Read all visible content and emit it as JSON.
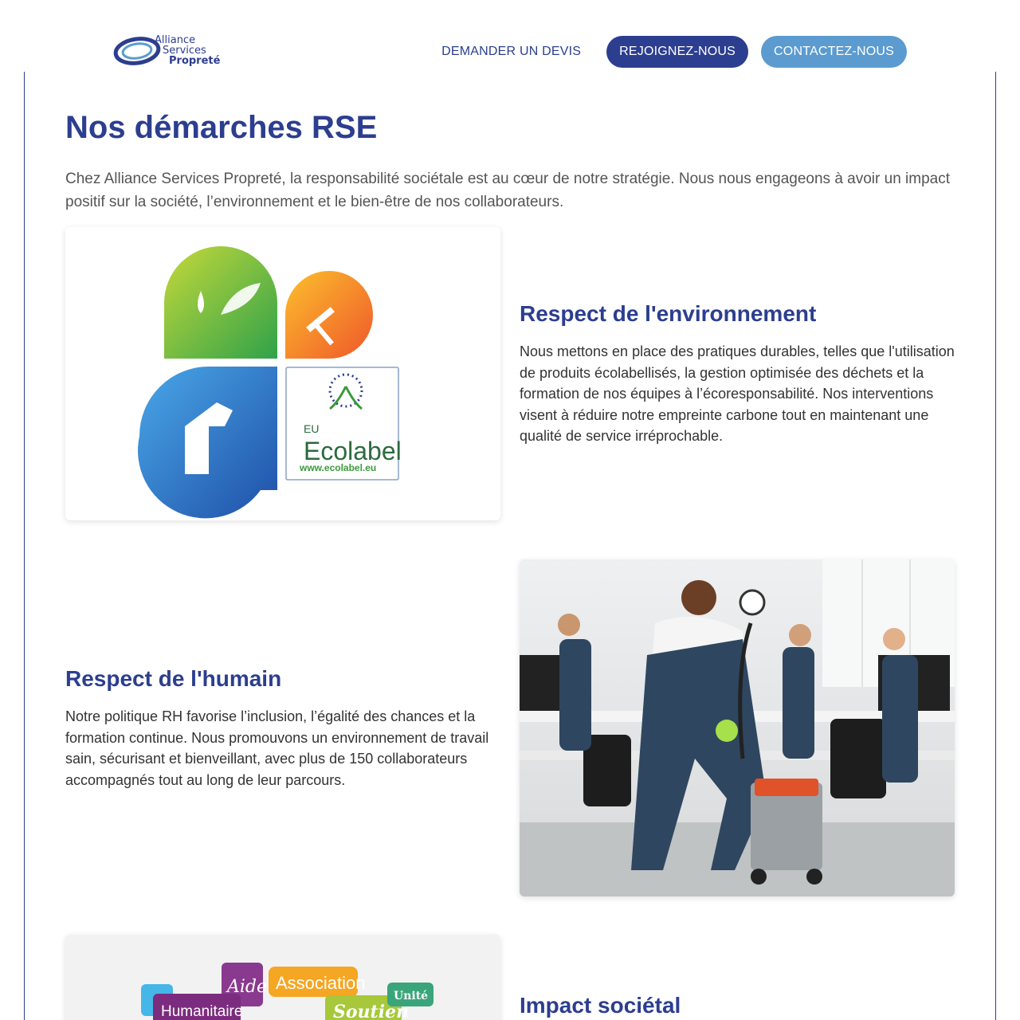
{
  "header": {
    "logo_line1": "Alliance",
    "logo_line2": "Services",
    "logo_line3": "Propreté",
    "nav_devis": "DEMANDER UN DEVIS",
    "nav_rejoignez": "REJOIGNEZ-NOUS",
    "nav_contact": "CONTACTEZ-NOUS"
  },
  "page": {
    "title": "Nos démarches RSE",
    "intro": "Chez Alliance Services Propreté, la responsabilité sociétale est au cœur de notre stratégie. Nous nous engageons à avoir un impact positif sur la société, l’environnement et le bien-être de nos collaborateurs."
  },
  "sections": [
    {
      "title": "Respect de l'environnement",
      "text": "Nous mettons en place des pratiques durables, telles que l'utilisation de produits écolabellisés, la gestion optimisée des déchets et la formation de nos équipes à l’écoresponsabilité. Nos interventions visent à réduire notre empreinte carbone tout en maintenant une qualité de service irréprochable.",
      "image_labels": {
        "eu": "EU",
        "ecolabel": "Ecolabel",
        "url": "www.ecolabel.eu"
      }
    },
    {
      "title": "Respect de l'humain",
      "text": "Notre politique RH favorise l’inclusion, l’égalité des chances et la formation continue. Nous promouvons un environnement de travail sain, sécurisant et bienveillant, avec plus de 150 collaborateurs accompagnés tout au long de leur parcours."
    },
    {
      "title": "Impact sociétal",
      "image_labels": {
        "aide": "Aide",
        "association": "Association",
        "humanitaire": "Humanitaire",
        "soutien": "Soutien",
        "unite": "Unité"
      }
    }
  ],
  "colors": {
    "brand_dark": "#2c3e8f",
    "brand_light": "#5b9bd0"
  }
}
